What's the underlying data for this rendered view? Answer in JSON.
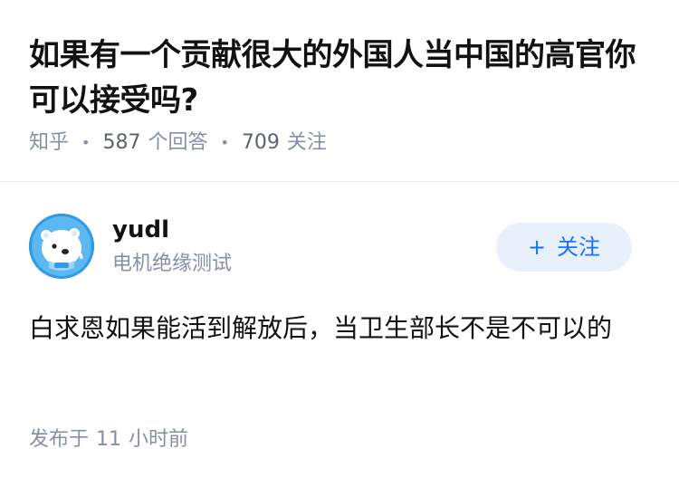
{
  "question": {
    "title": "如果有一个贡献很大的外国人当中国的高官你可以接受吗?",
    "source": "知乎",
    "answer_count": "587",
    "answer_label": "个回答",
    "follower_count": "709",
    "follower_label": "关注"
  },
  "answer": {
    "author": {
      "name": "yudl",
      "bio": "电机绝缘测试",
      "avatar_icon": "polar-bear-avatar"
    },
    "follow_button": {
      "plus": "+",
      "label": "关注"
    },
    "content": "白求恩如果能活到解放后，当卫生部长不是不可以的",
    "time_prefix": "发布于",
    "time_value": "11",
    "time_unit": "小时前"
  },
  "colors": {
    "primary": "#1772f6",
    "button_bg": "#e8f1fb",
    "meta_text": "#8590a6",
    "title_text": "#121212",
    "avatar_bg": "#2f9be6"
  }
}
